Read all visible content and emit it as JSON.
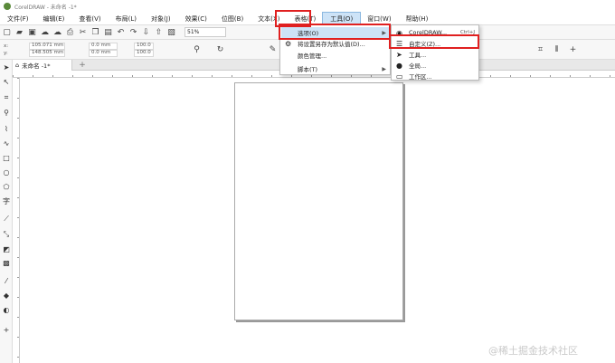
{
  "window": {
    "title": "CorelDRAW - 未命名 -1*"
  },
  "menubar": {
    "items": [
      "文件(F)",
      "编辑(E)",
      "查看(V)",
      "布局(L)",
      "对象(J)",
      "效果(C)",
      "位图(B)",
      "文本(X)",
      "表格(T)",
      "工具(O)",
      "窗口(W)",
      "帮助(H)"
    ]
  },
  "toolbar": {
    "zoom_value": "51%"
  },
  "property_bar": {
    "x": "105.071 mm",
    "y": "148.505 mm",
    "w": "0.0 mm",
    "h": "0.0 mm",
    "scale_w": "100.0",
    "scale_h": "100.0"
  },
  "doc_tab": {
    "label": "未命名 -1*"
  },
  "tools_menu": {
    "items": [
      {
        "label": "选项(O)",
        "has_submenu": true
      },
      {
        "label": "将设置另存为默认值(D)..."
      },
      {
        "label": "颜色管理..."
      },
      {
        "label": "脚本(T)",
        "has_submenu": true
      }
    ]
  },
  "options_submenu": {
    "items": [
      {
        "label": "CorelDRAW...",
        "shortcut": "Ctrl+J",
        "icon": "corel-icon"
      },
      {
        "label": "自定义(Z)...",
        "icon": "customize-icon"
      },
      {
        "label": "工具...",
        "icon": "arrow-tool-icon"
      },
      {
        "label": "全局...",
        "icon": "globe-icon"
      },
      {
        "label": "工作区...",
        "icon": "monitor-icon"
      }
    ]
  },
  "watermark": "@稀土掘金技术社区",
  "colors": {
    "highlight": "#cde3f7",
    "annotation": "#e02020"
  }
}
